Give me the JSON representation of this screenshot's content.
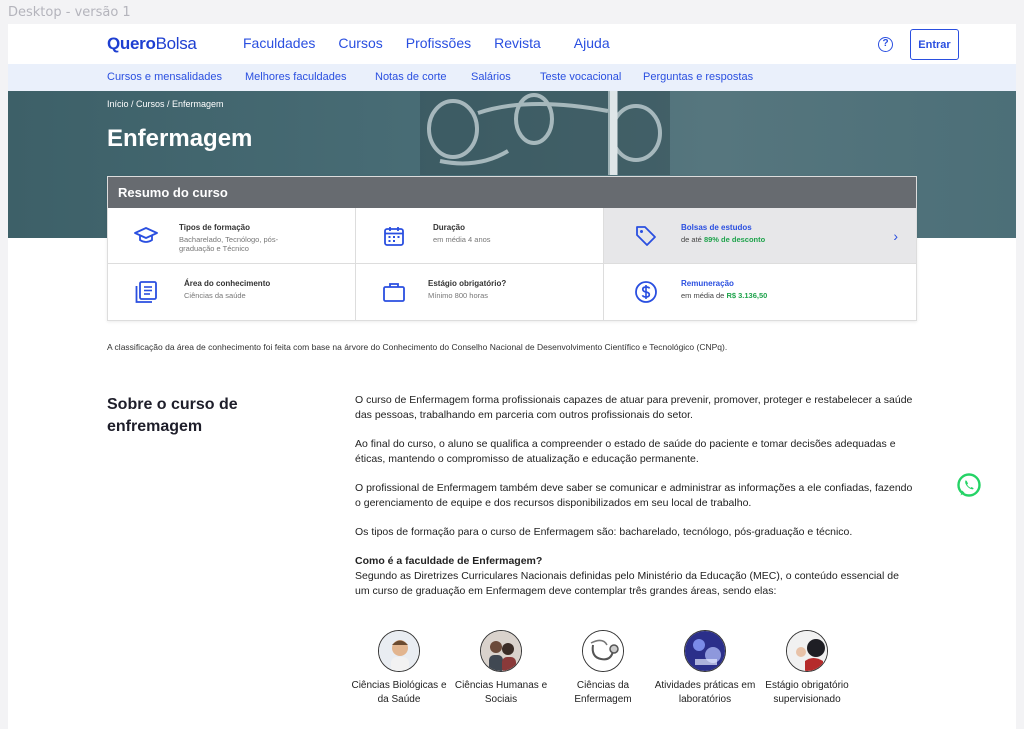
{
  "frame_label": "Desktop - versão 1",
  "logo": {
    "bold": "Quero",
    "light": "Bolsa"
  },
  "main_nav": [
    "Faculdades",
    "Cursos",
    "Profissões",
    "Revista",
    "Ajuda"
  ],
  "help_glyph": "?",
  "login_label": "Entrar",
  "sub_nav": [
    "Cursos e mensalidades",
    "Melhores faculdades",
    "Notas de corte",
    "Salários",
    "Teste vocacional",
    "Perguntas e respostas"
  ],
  "breadcrumb": "Início / Cursos / Enfermagem",
  "title": "Enfermagem",
  "summary": {
    "heading": "Resumo do curso",
    "cells": [
      {
        "icon": "graduation-cap-icon",
        "title": "Tipos de formação",
        "sub": "Bacharelado, Tecnólogo, pós-graduação e Técnico"
      },
      {
        "icon": "calendar-icon",
        "title": "Duração",
        "sub": "em média 4 anos"
      },
      {
        "icon": "price-tag-icon",
        "title": "Bolsas de estudos",
        "sub_prefix": "de até",
        "sub_highlight": "89% de desconto"
      },
      {
        "icon": "book-list-icon",
        "title": "Área do conhecimento",
        "sub": "Ciências da saúde"
      },
      {
        "icon": "briefcase-icon",
        "title": "Estágio obrigatório?",
        "sub": "Mínimo 800 horas"
      },
      {
        "icon": "dollar-coin-icon",
        "title": "Remuneração",
        "sub_prefix": "em média de",
        "sub_highlight": "R$ 3.136,50"
      }
    ]
  },
  "note": "A classificação da área de conhecimento foi feita com base na árvore do Conhecimento do Conselho Nacional de Desenvolvimento Científico e Tecnológico (CNPq).",
  "about_title": "Sobre o curso de enfremagem",
  "paragraphs": [
    "O curso de Enfermagem forma profissionais capazes de atuar para prevenir, promover, proteger e restabelecer a saúde das pessoas, trabalhando em parceria com outros profissionais do setor.",
    "Ao final do curso, o aluno se qualifica a compreender o estado de saúde do paciente e tomar decisões adequadas e éticas, mantendo o compromisso de atualização e educação permanente.",
    "O profissional de Enfermagem também deve saber se comunicar e administrar as informações a ele confiadas, fazendo o gerenciamento de equipe e dos recursos disponibilizados em seu local de trabalho.",
    "Os tipos de formação para o curso de Enfermagem são: bacharelado, tecnólogo, pós-graduação e técnico."
  ],
  "faculty_heading": "Como é a faculdade de Enfermagem?",
  "faculty_text": "Segundo as Diretrizes Curriculares Nacionais definidas pelo Ministério da Educação (MEC), o conteúdo essencial de um curso de graduação em Enfermagem deve contemplar três grandes áreas, sendo elas:",
  "areas": [
    {
      "label": "Ciências Biológicas e da Saúde"
    },
    {
      "label": "Ciências Humanas e Sociais"
    },
    {
      "label": "Ciências da Enfermagem"
    },
    {
      "label": "Atividades práticas em laboratórios"
    },
    {
      "label": "Estágio obrigatório supervisionado"
    }
  ],
  "colors": {
    "brand": "#2a4fe0",
    "highlight": "#1fa34c",
    "whatsapp": "#25d366"
  }
}
